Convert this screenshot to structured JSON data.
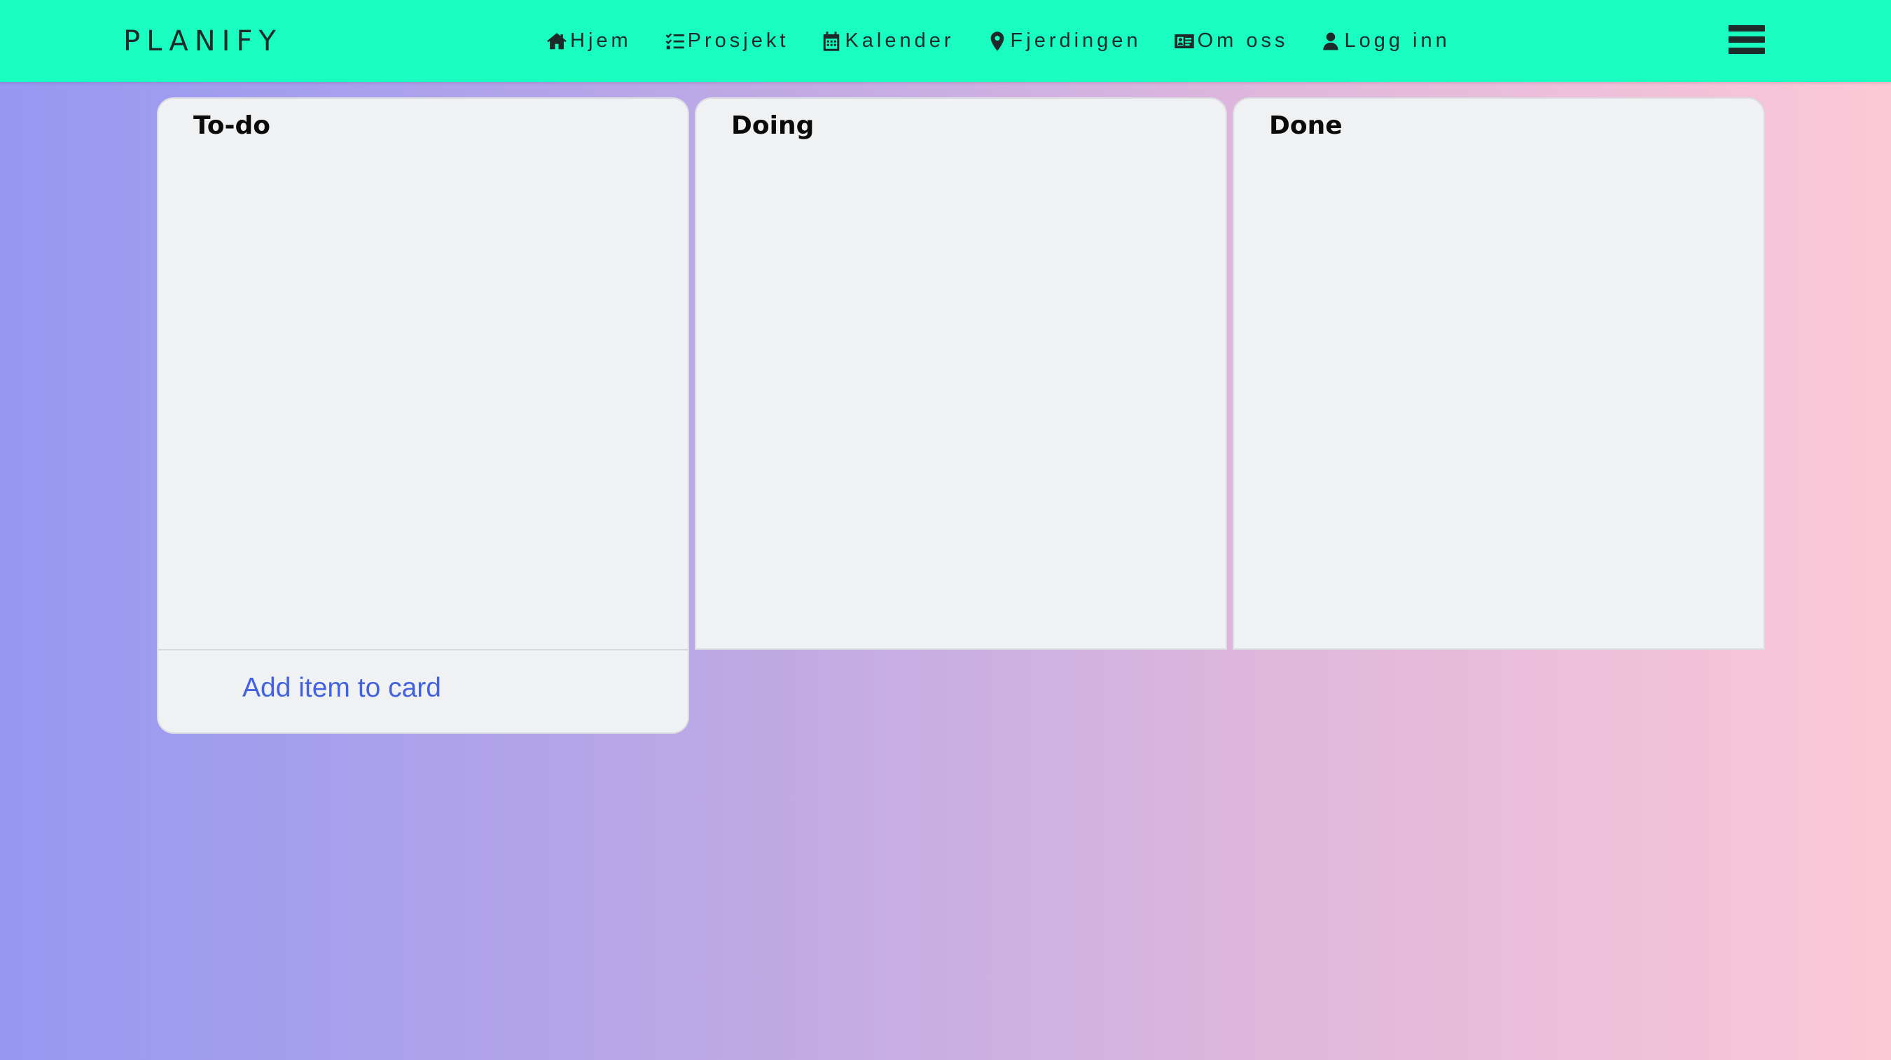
{
  "brand": "PLANIFY",
  "nav": [
    {
      "label": "Hjem",
      "icon": "home-icon"
    },
    {
      "label": "Prosjekt",
      "icon": "list-icon"
    },
    {
      "label": "Kalender",
      "icon": "calendar-icon"
    },
    {
      "label": "Fjerdingen",
      "icon": "map-pin-icon"
    },
    {
      "label": "Om oss",
      "icon": "id-card-icon"
    },
    {
      "label": "Logg inn",
      "icon": "user-icon"
    }
  ],
  "menu_icon": "hamburger-menu-icon",
  "board": {
    "columns": [
      {
        "title": "To-do",
        "footer_action": "Add item to card"
      },
      {
        "title": "Doing"
      },
      {
        "title": "Done"
      }
    ]
  },
  "colors": {
    "navbar": "#19fec0",
    "card": "#f0f1f3",
    "link": "#4262e0",
    "gradient_start": "#9698f2",
    "gradient_end": "#fbc8d6"
  }
}
